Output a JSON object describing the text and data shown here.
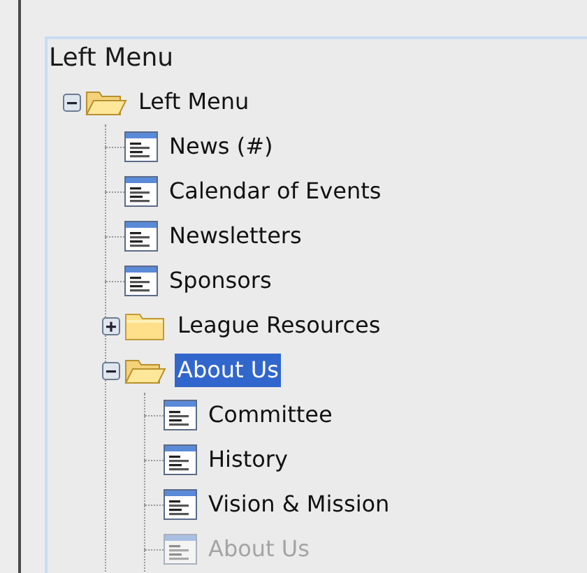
{
  "panel": {
    "title": "Left Menu"
  },
  "tree": [
    {
      "label": "Left Menu",
      "kind": "folder",
      "expanded": true,
      "selected": false,
      "disabled": false,
      "children": [
        {
          "label": "News (#)",
          "kind": "page",
          "selected": false,
          "disabled": false
        },
        {
          "label": "Calendar of Events",
          "kind": "page",
          "selected": false,
          "disabled": false
        },
        {
          "label": "Newsletters",
          "kind": "page",
          "selected": false,
          "disabled": false
        },
        {
          "label": "Sponsors",
          "kind": "page",
          "selected": false,
          "disabled": false
        },
        {
          "label": "League Resources",
          "kind": "folder",
          "expanded": false,
          "selected": false,
          "disabled": false
        },
        {
          "label": "About Us",
          "kind": "folder",
          "expanded": true,
          "selected": true,
          "disabled": false,
          "children": [
            {
              "label": "Committee",
              "kind": "page",
              "selected": false,
              "disabled": false
            },
            {
              "label": "History",
              "kind": "page",
              "selected": false,
              "disabled": false
            },
            {
              "label": "Vision & Mission",
              "kind": "page",
              "selected": false,
              "disabled": false
            },
            {
              "label": "About Us",
              "kind": "page",
              "selected": false,
              "disabled": true
            }
          ]
        }
      ]
    }
  ]
}
